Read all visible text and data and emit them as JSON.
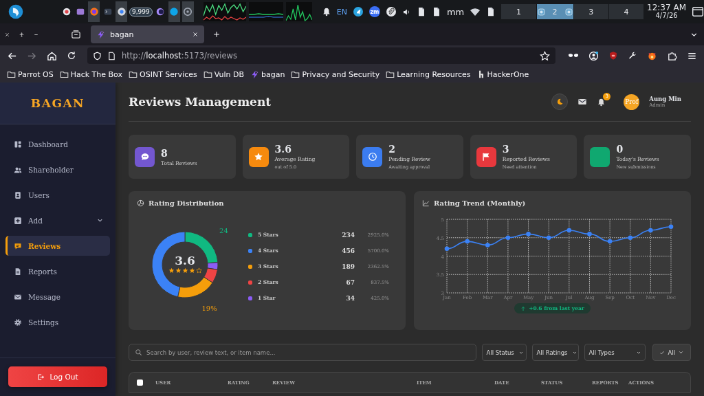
{
  "system_panel": {
    "badge": "9,999",
    "keyboard_layout": "EN",
    "meeting_app": "zm",
    "tray_text": "mm",
    "workspaces": [
      {
        "label": "1",
        "selected": false
      },
      {
        "label": "2",
        "selected": true
      },
      {
        "label": "3",
        "selected": false
      },
      {
        "label": "4",
        "selected": false
      }
    ],
    "clock": {
      "time": "12:37 AM",
      "date": "4/7/26"
    }
  },
  "browser": {
    "tabs": [
      {
        "title": "bagan",
        "selected": true
      }
    ],
    "forward_disabled": true,
    "url": {
      "scheme": "http://",
      "host": "localhost",
      "path": ":5173/reviews"
    },
    "bookmarks": [
      {
        "label": "Parrot OS",
        "kind": "folder"
      },
      {
        "label": "Hack The Box",
        "kind": "folder"
      },
      {
        "label": "OSINT Services",
        "kind": "folder"
      },
      {
        "label": "Vuln DB",
        "kind": "folder"
      },
      {
        "label": "bagan",
        "kind": "bolt"
      },
      {
        "label": "Privacy and Security",
        "kind": "folder"
      },
      {
        "label": "Learning Resources",
        "kind": "folder"
      },
      {
        "label": "HackerOne",
        "kind": "logo"
      }
    ]
  },
  "sidebar": {
    "logo": "BAGAN",
    "items": [
      {
        "label": "Dashboard",
        "kind": "link",
        "selected": false
      },
      {
        "label": "Shareholder",
        "kind": "link",
        "selected": false
      },
      {
        "label": "Users",
        "kind": "link",
        "selected": false
      },
      {
        "label": "Add",
        "kind": "group",
        "selected": false
      },
      {
        "label": "Reviews",
        "kind": "link",
        "selected": true
      },
      {
        "label": "Reports",
        "kind": "link",
        "selected": false
      },
      {
        "label": "Message",
        "kind": "link",
        "selected": false
      },
      {
        "label": "Settings",
        "kind": "link",
        "selected": false
      }
    ],
    "logout": "Log Out"
  },
  "header": {
    "title": "Reviews Management",
    "notifications": "3",
    "avatar": "Prof",
    "user_name": "Aung Min",
    "user_role": "Admin"
  },
  "stats": [
    {
      "value": "8",
      "label": "Total Reviews",
      "kind": "chat",
      "color": "#7357d0"
    },
    {
      "value": "3.6",
      "label": "Average Rating",
      "note": "out of 5.0",
      "kind": "star",
      "color": "#f68a0e"
    },
    {
      "value": "2",
      "label": "Pending Review",
      "note": "Awaiting approval",
      "kind": "clock",
      "color": "#3b7cf0"
    },
    {
      "value": "3",
      "label": "Reported Reviews",
      "note": "Need attention",
      "kind": "flag",
      "color": "#e8383d"
    },
    {
      "value": "0",
      "label": "Today's Reviews",
      "note": "New submissions",
      "kind": "blank",
      "color": "#10a870"
    }
  ],
  "rating_distribution": {
    "title": "Rating Distribution",
    "average": "3.6",
    "stars": 4,
    "chart_data": {
      "type": "donut",
      "values": [
        23.9,
        3.5,
        6.8,
        19.3,
        46.5
      ],
      "colors": [
        "#10b981",
        "#8b5cf6",
        "#ef4444",
        "#f59e0b",
        "#3b82f6"
      ],
      "value_labels": [
        "24",
        null,
        null,
        "19%",
        null
      ]
    },
    "legend": [
      {
        "label": "5 Stars",
        "count": "234",
        "percent": "2925.0%",
        "color": "#10b981"
      },
      {
        "label": "4 Stars",
        "count": "456",
        "percent": "5700.0%",
        "color": "#3b82f6"
      },
      {
        "label": "3 Stars",
        "count": "189",
        "percent": "2362.5%",
        "color": "#f59e0b"
      },
      {
        "label": "2 Stars",
        "count": "67",
        "percent": "837.5%",
        "color": "#ef4444"
      },
      {
        "label": "1 Star",
        "count": "34",
        "percent": "425.0%",
        "color": "#8b5cf6"
      }
    ]
  },
  "rating_trend": {
    "title": "Rating Trend (Monthly)",
    "chart_data": {
      "type": "line",
      "categories": [
        "Jan",
        "Feb",
        "Mar",
        "Apr",
        "May",
        "Jun",
        "Jul",
        "Aug",
        "Sep",
        "Oct",
        "Nov",
        "Dec"
      ],
      "series": [
        {
          "color": "#3b82f6",
          "marker": "circle",
          "values": [
            4.2,
            4.4,
            4.3,
            4.5,
            4.6,
            4.5,
            4.7,
            4.6,
            4.4,
            4.5,
            4.7,
            4.8
          ]
        }
      ],
      "grid": true,
      "ylim": [
        3,
        5
      ],
      "yticks": [
        {
          "value": 3,
          "label": "3"
        },
        {
          "value": 3.5,
          "label": "3.5"
        },
        {
          "value": 4,
          "label": "4"
        },
        {
          "value": 4.5,
          "label": "4.5"
        },
        {
          "value": 5,
          "label": "5"
        }
      ]
    },
    "change": "+0.6 from last year"
  },
  "filters": {
    "search_placeholder": "Search by user, review text, or item name...",
    "selects": [
      "All Status",
      "All Ratings",
      "All Types"
    ],
    "button": "All"
  },
  "table": {
    "select_all_checked": false,
    "columns": [
      "USER",
      "RATING",
      "REVIEW",
      "ITEM",
      "DATE",
      "STATUS",
      "REPORTS",
      "ACTIONS"
    ]
  }
}
